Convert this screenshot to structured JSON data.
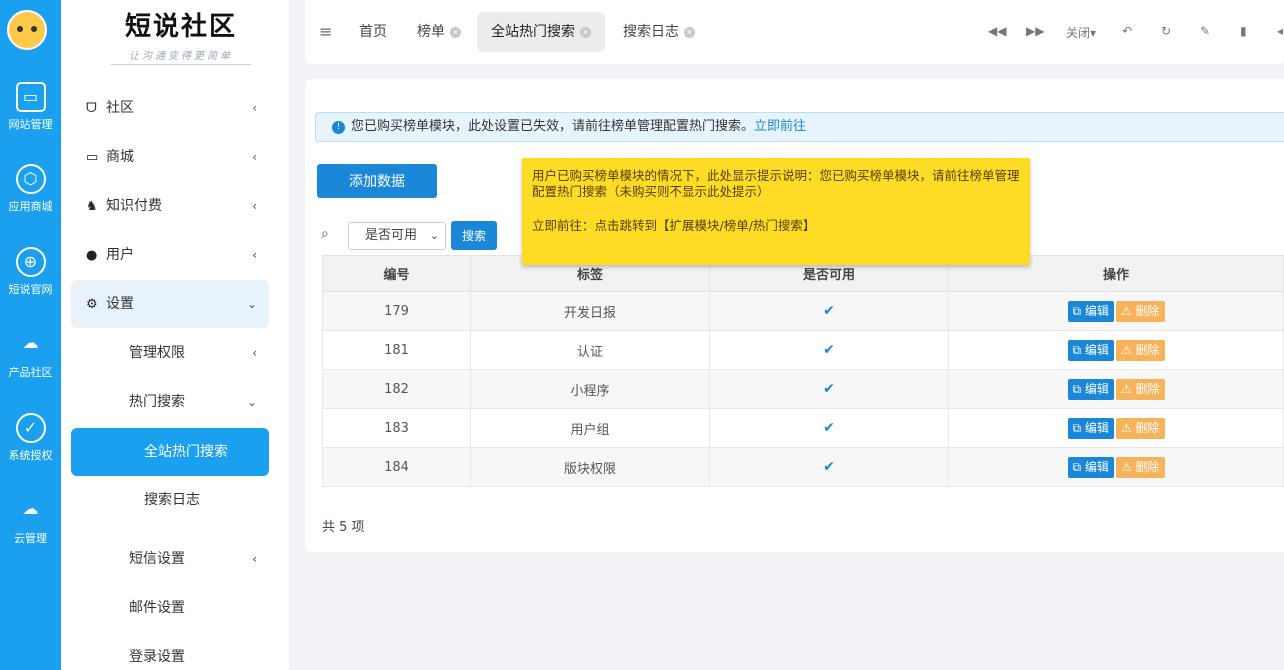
{
  "rail": {
    "items": [
      {
        "label": "网站管理",
        "icon": "monitor-icon"
      },
      {
        "label": "应用商城",
        "icon": "box-icon"
      },
      {
        "label": "短说官网",
        "icon": "globe-icon"
      },
      {
        "label": "产品社区",
        "icon": "cloud-icon"
      },
      {
        "label": "系统授权",
        "icon": "shield-check-icon"
      },
      {
        "label": "云管理",
        "icon": "cloud-storage-icon"
      }
    ]
  },
  "brand": {
    "title": "短说社区",
    "subtitle": "让沟通变得更简单"
  },
  "sidebar": {
    "items": [
      {
        "label": "社区",
        "arrow": "‹"
      },
      {
        "label": "商城",
        "arrow": "‹"
      },
      {
        "label": "知识付费",
        "arrow": "‹"
      },
      {
        "label": "用户",
        "arrow": "‹"
      },
      {
        "label": "设置",
        "arrow": "⌄"
      },
      {
        "label": "管理权限",
        "arrow": "‹"
      },
      {
        "label": "热门搜索",
        "arrow": "⌄"
      },
      {
        "label": "全站热门搜索"
      },
      {
        "label": "搜索日志"
      },
      {
        "label": "短信设置",
        "arrow": "‹"
      },
      {
        "label": "邮件设置"
      },
      {
        "label": "登录设置"
      }
    ]
  },
  "tabs": [
    {
      "label": "首页"
    },
    {
      "label": "榜单"
    },
    {
      "label": "全站热门搜索"
    },
    {
      "label": "搜索日志"
    }
  ],
  "toolbar": {
    "close_label": "关闭▾"
  },
  "alert": {
    "text": "您已购买榜单模块，此处设置已失效，请前往榜单管理配置热门搜索。",
    "link": "立即前往"
  },
  "actions": {
    "add_label": "添加数据",
    "search_label": "搜索",
    "filter_value": "是否可用"
  },
  "table": {
    "headers": [
      "编号",
      "标签",
      "是否可用",
      "操作"
    ],
    "rows": [
      {
        "id": "179",
        "tag": "开发日报"
      },
      {
        "id": "181",
        "tag": "认证"
      },
      {
        "id": "182",
        "tag": "小程序"
      },
      {
        "id": "183",
        "tag": "用户组"
      },
      {
        "id": "184",
        "tag": "版块权限"
      }
    ],
    "edit_label": "编辑",
    "delete_label": "删除"
  },
  "footer": {
    "total": "共 5 项"
  },
  "tooltip": {
    "line1": "用户已购买榜单模块的情况下，此处显示提示说明：您已购买榜单模块，请前往榜单管理配置热门搜索（未购买则不显示此处提示）",
    "line2": "立即前往：点击跳转到【扩展模块/榜单/热门搜索】"
  }
}
